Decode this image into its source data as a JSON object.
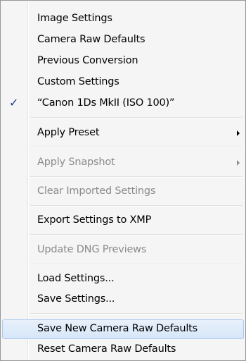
{
  "menu": {
    "items": [
      {
        "label": "Image Settings"
      },
      {
        "label": "Camera Raw Defaults"
      },
      {
        "label": "Previous Conversion"
      },
      {
        "label": "Custom Settings"
      },
      {
        "label": "“Canon 1Ds MkII (ISO 100)”",
        "checked": true
      },
      {
        "label": "Apply Preset",
        "submenu": true
      },
      {
        "label": "Apply Snapshot",
        "submenu": true,
        "disabled": true
      },
      {
        "label": "Clear Imported Settings",
        "disabled": true
      },
      {
        "label": "Export Settings to XMP"
      },
      {
        "label": "Update DNG Previews",
        "disabled": true
      },
      {
        "label": "Load Settings..."
      },
      {
        "label": "Save Settings..."
      },
      {
        "label": "Save New Camera Raw Defaults",
        "highlighted": true
      },
      {
        "label": "Reset Camera Raw Defaults"
      }
    ],
    "check_glyph": "✓",
    "colors": {
      "check": "#1c3c9c",
      "disabled_text": "#8b8b8b",
      "highlight_border": "#a9c8ec"
    }
  }
}
